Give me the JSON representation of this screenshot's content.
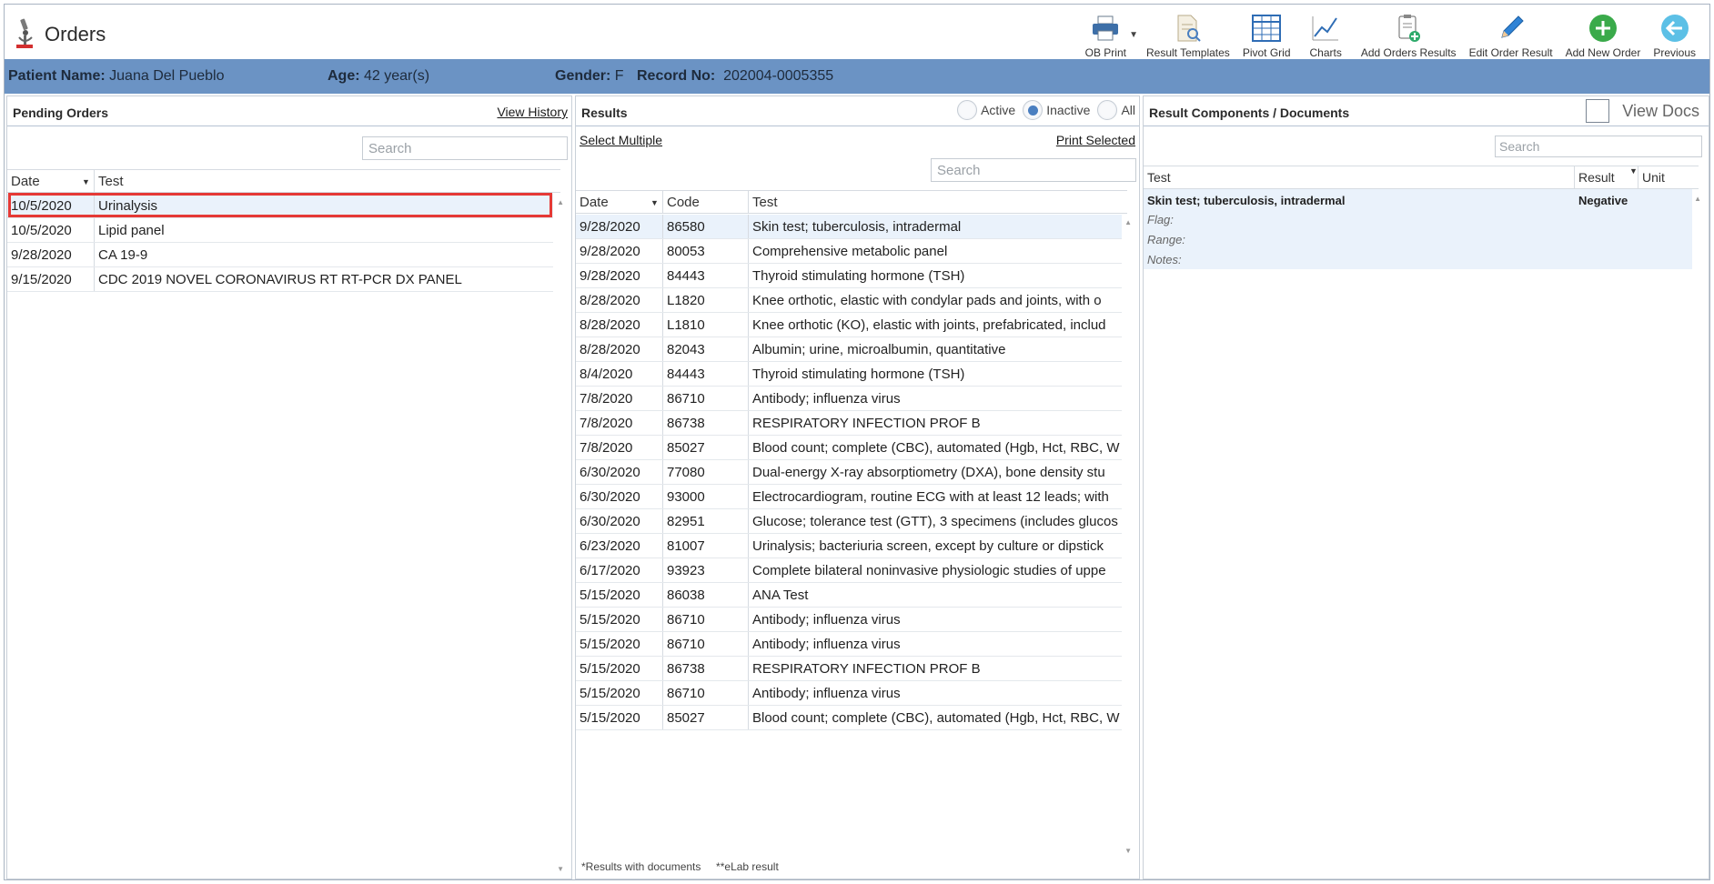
{
  "app": {
    "title": "Orders"
  },
  "toolbar": {
    "items": [
      {
        "name": "ob-print-button",
        "label": "OB Print",
        "icon": "printer-icon"
      },
      {
        "name": "result-templates-button",
        "label": "Result Templates",
        "icon": "template-icon"
      },
      {
        "name": "pivot-grid-button",
        "label": "Pivot Grid",
        "icon": "grid-icon"
      },
      {
        "name": "charts-button",
        "label": "Charts",
        "icon": "chart-icon"
      },
      {
        "name": "add-orders-results-button",
        "label": "Add Orders Results",
        "icon": "add-document-icon"
      },
      {
        "name": "edit-order-result-button",
        "label": "Edit Order Result",
        "icon": "pencil-icon"
      },
      {
        "name": "add-new-order-button",
        "label": "Add New Order",
        "icon": "plus-circle-icon"
      },
      {
        "name": "previous-button",
        "label": "Previous",
        "icon": "back-arrow-icon"
      }
    ]
  },
  "patient": {
    "name_label": "Patient Name:",
    "name": "Juana Del Pueblo",
    "age_label": "Age:",
    "age": "42 year(s)",
    "gender_label": "Gender:",
    "gender": "F",
    "record_label": "Record No:",
    "record": "202004-0005355"
  },
  "pending": {
    "title": "Pending Orders",
    "view_history": "View History",
    "search_placeholder": "Search",
    "columns": {
      "date": "Date",
      "test": "Test"
    },
    "rows": [
      {
        "date": "10/5/2020",
        "test": "Urinalysis"
      },
      {
        "date": "10/5/2020",
        "test": "Lipid panel"
      },
      {
        "date": "9/28/2020",
        "test": "CA 19-9"
      },
      {
        "date": "9/15/2020",
        "test": "CDC 2019 NOVEL CORONAVIRUS RT RT-PCR DX PANEL"
      }
    ]
  },
  "results": {
    "title": "Results",
    "filters": {
      "active": "Active",
      "inactive": "Inactive",
      "all": "All",
      "selected": "inactive"
    },
    "select_multiple": "Select Multiple",
    "print_selected": "Print Selected",
    "search_placeholder": "Search",
    "columns": {
      "date": "Date",
      "code": "Code",
      "test": "Test"
    },
    "rows": [
      {
        "date": "9/28/2020",
        "code": "86580",
        "test": "Skin test; tuberculosis, intradermal"
      },
      {
        "date": "9/28/2020",
        "code": "80053",
        "test": "Comprehensive metabolic panel"
      },
      {
        "date": "9/28/2020",
        "code": "84443",
        "test": "Thyroid stimulating hormone (TSH)"
      },
      {
        "date": "8/28/2020",
        "code": "L1820",
        "test": "Knee orthotic, elastic with condylar pads and joints, with o"
      },
      {
        "date": "8/28/2020",
        "code": "L1810",
        "test": "Knee orthotic (KO), elastic with joints, prefabricated, includ"
      },
      {
        "date": "8/28/2020",
        "code": "82043",
        "test": "Albumin; urine, microalbumin, quantitative"
      },
      {
        "date": "8/4/2020",
        "code": "84443",
        "test": "Thyroid stimulating hormone (TSH)"
      },
      {
        "date": "7/8/2020",
        "code": "86710",
        "test": "Antibody; influenza virus"
      },
      {
        "date": "7/8/2020",
        "code": "86738",
        "test": "RESPIRATORY INFECTION PROF B"
      },
      {
        "date": "7/8/2020",
        "code": "85027",
        "test": "Blood count; complete (CBC), automated (Hgb, Hct, RBC, W"
      },
      {
        "date": "6/30/2020",
        "code": "77080",
        "test": "Dual-energy X-ray absorptiometry (DXA), bone density stu"
      },
      {
        "date": "6/30/2020",
        "code": "93000",
        "test": "Electrocardiogram, routine ECG with at least 12 leads; with"
      },
      {
        "date": "6/30/2020",
        "code": "82951",
        "test": "Glucose; tolerance test (GTT), 3 specimens (includes glucos"
      },
      {
        "date": "6/23/2020",
        "code": "81007",
        "test": "Urinalysis; bacteriuria screen, except by culture or dipstick"
      },
      {
        "date": "6/17/2020",
        "code": "93923",
        "test": "Complete bilateral noninvasive physiologic studies of uppe"
      },
      {
        "date": "5/15/2020",
        "code": "86038",
        "test": "ANA Test"
      },
      {
        "date": "5/15/2020",
        "code": "86710",
        "test": "Antibody; influenza virus"
      },
      {
        "date": "5/15/2020",
        "code": "86710",
        "test": "Antibody; influenza virus"
      },
      {
        "date": "5/15/2020",
        "code": "86738",
        "test": "RESPIRATORY INFECTION PROF B"
      },
      {
        "date": "5/15/2020",
        "code": "86710",
        "test": "Antibody; influenza virus"
      },
      {
        "date": "5/15/2020",
        "code": "85027",
        "test": "Blood count; complete (CBC), automated (Hgb, Hct, RBC, W"
      }
    ],
    "footnote": "*Results with documents     **eLab result"
  },
  "components": {
    "title": "Result Components / Documents",
    "view_docs": "View Docs",
    "search_placeholder": "Search",
    "columns": {
      "test": "Test",
      "result": "Result",
      "unit": "Unit"
    },
    "row": {
      "test": "Skin test; tuberculosis, intradermal",
      "result": "Negative",
      "unit": ""
    },
    "labels": {
      "flag": "Flag:",
      "range": "Range:",
      "notes": "Notes:"
    }
  },
  "colors": {
    "patient_bar": "#6b93c4",
    "selection": "#eaf2fb",
    "highlight": "#e53935",
    "accent": "#4a7fc0"
  }
}
